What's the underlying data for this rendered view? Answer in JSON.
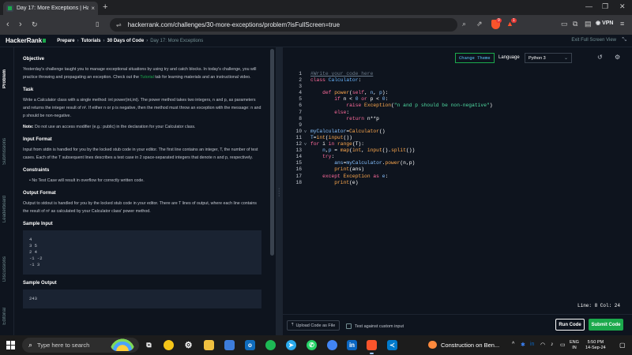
{
  "browser": {
    "tab_title": "Day 17: More Exceptions | Hack",
    "tab_close": "×",
    "new_tab": "+",
    "url": "hackerrank.com/challenges/30-more-exceptions/problem?isFullScreen=true",
    "vpn_label": "VPN",
    "badge_count_1": "9",
    "badge_count_2": "1"
  },
  "header": {
    "logo": "HackerRank",
    "crumbs": [
      "Prepare",
      "Tutorials",
      "30 Days of Code"
    ],
    "current": "Day 17: More Exceptions",
    "exit_fullscreen": "Exit Full Screen View"
  },
  "vtabs": [
    "Problem",
    "Submissions",
    "Leaderboard",
    "Discussions",
    "Editorial"
  ],
  "problem": {
    "objective_h": "Objective",
    "objective_p1": "Yesterday's challenge taught you to manage exceptional situations by using try and catch blocks. In today's challenge, you will practice throwing and propagating an exception. Check out the ",
    "objective_link": "Tutorial",
    "objective_p2": " tab for learning materials and an instructional video.",
    "task_h": "Task",
    "task_p": "Write a Calculator class with a single method: int power(int,int). The power method takes two integers, n and p, as parameters and returns the integer result of nᵖ. If either n or p is negative, then the method must throw an exception with the message: n and p should be non-negative.",
    "note_label": "Note:",
    "note_p": " Do not use an access modifier (e.g.: public) in the declaration for your Calculator class.",
    "input_h": "Input Format",
    "input_p": "Input from stdin is handled for you by the locked stub code in your editor. The first line contains an integer, T, the number of test cases. Each of the T subsequent lines describes a test case in 2 space-separated integers that denote n and p, respectively.",
    "constraints_h": "Constraints",
    "constraints_item": "No Test Case will result in overflow for correctly written code.",
    "output_h": "Output Format",
    "output_p": "Output to stdout is handled for you by the locked stub code in your editor. There are T lines of output, where each line contains the result of nᵖ as calculated by your Calculator class' power method.",
    "sample_in_h": "Sample Input",
    "sample_in": [
      "4",
      "3 5",
      "2 4",
      "-1 -2",
      "-1 3"
    ],
    "sample_out_h": "Sample Output",
    "sample_out": [
      "243"
    ]
  },
  "editor": {
    "change_theme": "Change Theme",
    "language_label": "Language",
    "language": "Python 3",
    "status": "Line: 8 Col: 24",
    "upload": "Upload Code as File",
    "custom_input": "Test against custom input",
    "run": "Run Code",
    "submit": "Submit Code"
  },
  "code_lines": [
    {
      "n": "1",
      "fold": ""
    },
    {
      "n": "2",
      "fold": ""
    },
    {
      "n": "3",
      "fold": ""
    },
    {
      "n": "4",
      "fold": ""
    },
    {
      "n": "5",
      "fold": ""
    },
    {
      "n": "6",
      "fold": ""
    },
    {
      "n": "7",
      "fold": ""
    },
    {
      "n": "8",
      "fold": ""
    },
    {
      "n": "9",
      "fold": ""
    },
    {
      "n": "10",
      "fold": "v"
    },
    {
      "n": "11",
      "fold": ""
    },
    {
      "n": "12",
      "fold": "v"
    },
    {
      "n": "13",
      "fold": ""
    },
    {
      "n": "14",
      "fold": ""
    },
    {
      "n": "15",
      "fold": ""
    },
    {
      "n": "16",
      "fold": ""
    },
    {
      "n": "17",
      "fold": ""
    },
    {
      "n": "18",
      "fold": ""
    }
  ],
  "code_text": [
    "#Write your code here",
    "class Calculator:",
    "",
    "    def power(self, n, p):",
    "        if n < 0 or p < 0:",
    "            raise Exception(\"n and p should be non-negative\")",
    "        else:",
    "            return n**p",
    "",
    "myCalculator=Calculator()",
    "T=int(input())",
    "for i in range(T):",
    "    n,p = map(int, input().split())",
    "    try:",
    "        ans=myCalculator.power(n,p)",
    "        print(ans)",
    "    except Exception as e:",
    "        print(e)"
  ],
  "taskbar": {
    "search_placeholder": "Type here to search",
    "weather": "Construction on Ben...",
    "lang_1": "ENG",
    "lang_2": "IN",
    "time": "5:50 PM",
    "date": "14-Sep-24"
  }
}
